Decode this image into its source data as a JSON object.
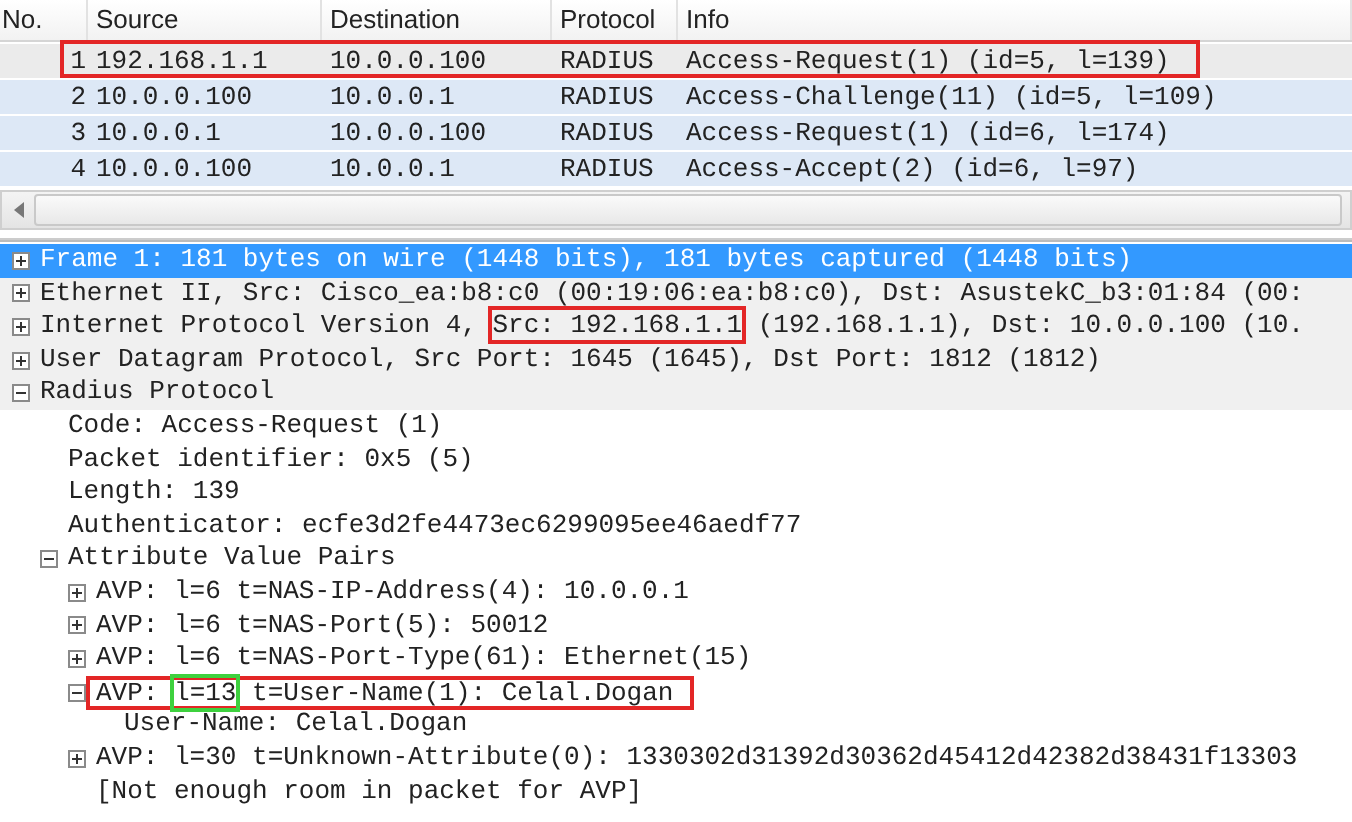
{
  "packet_list": {
    "columns": [
      "No.",
      "Source",
      "Destination",
      "Protocol",
      "Info"
    ],
    "rows": [
      {
        "cells": [
          "1",
          "192.168.1.1",
          "10.0.0.100",
          "RADIUS",
          "Access-Request(1) (id=5, l=139)"
        ],
        "selected": true,
        "color": "#e32626"
      },
      {
        "cells": [
          "2",
          "10.0.0.100",
          "10.0.0.1",
          "RADIUS",
          "Access-Challenge(11) (id=5, l=109)"
        ],
        "selected": false
      },
      {
        "cells": [
          "3",
          "10.0.0.1",
          "10.0.0.100",
          "RADIUS",
          "Access-Request(1) (id=6, l=174)"
        ],
        "selected": false
      },
      {
        "cells": [
          "4",
          "10.0.0.100",
          "10.0.0.1",
          "RADIUS",
          "Access-Accept(2) (id=6, l=97)"
        ],
        "selected": false
      }
    ]
  },
  "details": [
    {
      "text": "Frame 1: 181 bytes on wire (1448 bits), 181 bytes captured (1448 bits)",
      "expanded": false,
      "selected": true
    },
    {
      "text": "Ethernet II, Src: Cisco_ea:b8:c0 (00:19:06:ea:b8:c0), Dst: AsustekC_b3:01:84 (00:",
      "expanded": false,
      "selected": false
    },
    {
      "parts": [
        {
          "text": "Internet Protocol Version 4, "
        },
        {
          "text": "Src: 192.168.1.1",
          "color": "#e32626"
        },
        {
          "text": " (192.168.1.1), Dst: 10.0.0.100 (10."
        }
      ],
      "expanded": false,
      "selected": false
    },
    {
      "text": "User Datagram Protocol, Src Port: 1645 (1645), Dst Port: 1812 (1812)",
      "expanded": false,
      "selected": false
    },
    {
      "text": "Radius Protocol",
      "expanded": true,
      "selected": false,
      "children": [
        {
          "text": "Code: Access-Request (1)"
        },
        {
          "text": "Packet identifier: 0x5 (5)"
        },
        {
          "text": "Length: 139"
        },
        {
          "text": "Authenticator: ecfe3d2fe4473ec6299095ee46aedf77"
        },
        {
          "text": "Attribute Value Pairs",
          "expanded": true,
          "children": [
            {
              "text": "AVP: l=6 t=NAS-IP-Address(4): 10.0.0.1",
              "expanded": false
            },
            {
              "text": "AVP: l=6 t=NAS-Port(5): 50012",
              "expanded": false
            },
            {
              "text": "AVP: l=6 t=NAS-Port-Type(61): Ethernet(15)",
              "expanded": false
            },
            {
              "parts": [
                {
                  "text": "AVP: "
                },
                {
                  "text": "l=13",
                  "color": "#3ed13e"
                },
                {
                  "text": " t=User-Name(1): Celal.Dogan"
                }
              ],
              "expanded": true,
              "color": "#e32626",
              "children": [
                {
                  "text": "User-Name: Celal.Dogan"
                }
              ]
            },
            {
              "text": "AVP: l=30 t=Unknown-Attribute(0): 1330302d31392d30362d45412d42382d38431f13303",
              "expanded": false
            },
            {
              "text": "[Not enough room in packet for AVP]"
            }
          ]
        }
      ]
    }
  ]
}
